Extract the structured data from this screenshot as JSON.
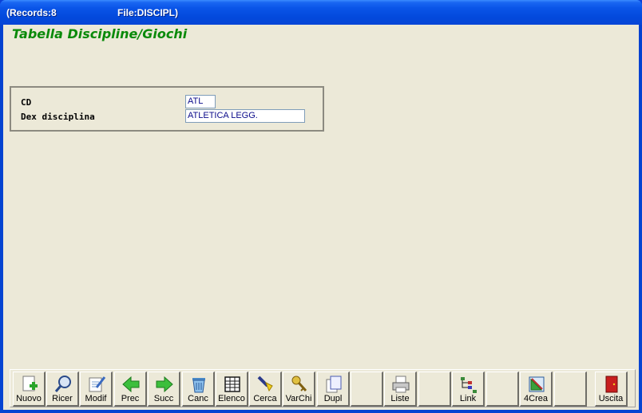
{
  "titlebar": {
    "records": "(Records:8",
    "file": "File:DISCIPL)"
  },
  "form": {
    "title": "Tabella Discipline/Giochi",
    "fields": {
      "cd": {
        "label": "CD",
        "value": "ATL"
      },
      "dex": {
        "label": "Dex disciplina",
        "value": "ATLETICA LEGG."
      }
    }
  },
  "toolbar": {
    "buttons": [
      {
        "label": "Nuovo",
        "icon": "new-doc-icon"
      },
      {
        "label": "Ricer",
        "icon": "search-icon"
      },
      {
        "label": "Modif",
        "icon": "edit-doc-icon"
      },
      {
        "label": "Prec",
        "icon": "arrow-left-icon"
      },
      {
        "label": "Succ",
        "icon": "arrow-right-icon"
      },
      {
        "label": "Canc",
        "icon": "trash-icon"
      },
      {
        "label": "Elenco",
        "icon": "table-icon"
      },
      {
        "label": "Cerca",
        "icon": "flashlight-icon"
      },
      {
        "label": "VarChi",
        "icon": "keys-icon"
      },
      {
        "label": "Dupl",
        "icon": "duplicate-icon"
      },
      {
        "label": "",
        "icon": ""
      },
      {
        "label": "Liste",
        "icon": "printer-icon"
      },
      {
        "label": "",
        "icon": ""
      },
      {
        "label": "Link",
        "icon": "tree-icon"
      },
      {
        "label": "",
        "icon": ""
      },
      {
        "label": "4Crea",
        "icon": "tools-icon"
      },
      {
        "label": "",
        "icon": ""
      },
      {
        "label": "Uscita",
        "icon": "exit-door-icon"
      }
    ]
  },
  "colors": {
    "title_green": "#0a8a0a",
    "field_text": "#0a0a8a",
    "face": "#ece9d8"
  }
}
